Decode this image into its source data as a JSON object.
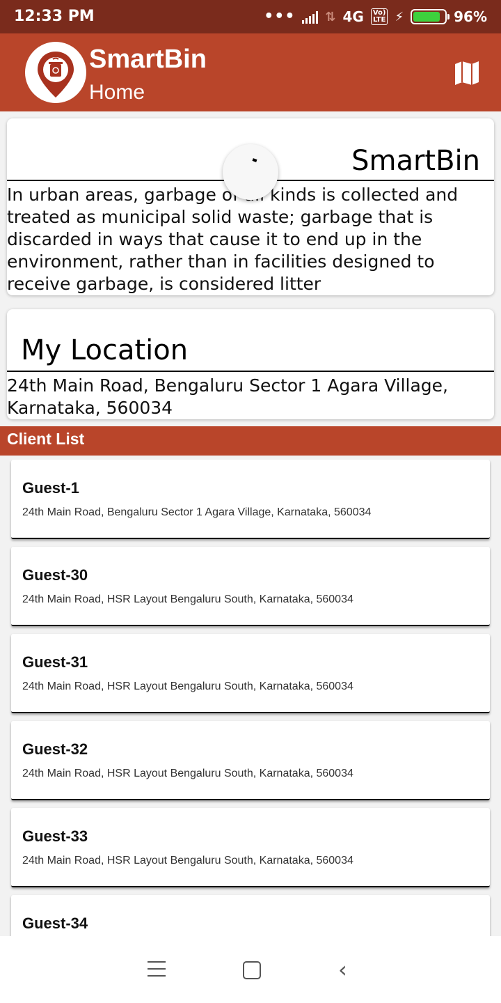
{
  "status_bar": {
    "time": "12:33 PM",
    "dots": "•••",
    "network": "4G",
    "volte": "Vo) LTE",
    "battery_level_percent": 96,
    "battery_text": "96%"
  },
  "app_bar": {
    "title": "SmartBin",
    "subtitle": "Home",
    "map_icon": "map-icon",
    "logo_icon": "smartbin-logo-icon"
  },
  "info_card": {
    "title": "SmartBin",
    "body": "In urban areas, garbage of all kinds is collected and treated as municipal solid waste; garbage that is discarded in ways that cause it to end up in the environment, rather than in facilities designed to receive garbage, is considered litter"
  },
  "location_card": {
    "title": "My Location",
    "address": "24th Main Road, Bengaluru Sector 1 Agara Village, Karnataka, 560034"
  },
  "client_list": {
    "header": "Client List",
    "items": [
      {
        "name": "Guest-1",
        "address": "24th Main Road, Bengaluru Sector 1 Agara Village, Karnataka, 560034"
      },
      {
        "name": "Guest-30",
        "address": "24th Main Road, HSR Layout Bengaluru South, Karnataka, 560034"
      },
      {
        "name": "Guest-31",
        "address": "24th Main Road, HSR Layout Bengaluru South, Karnataka, 560034"
      },
      {
        "name": "Guest-32",
        "address": "24th Main Road, HSR Layout Bengaluru South, Karnataka, 560034"
      },
      {
        "name": "Guest-33",
        "address": "24th Main Road, HSR Layout Bengaluru South, Karnataka, 560034"
      },
      {
        "name": "Guest-34",
        "address": ""
      }
    ]
  },
  "nav_bar": {
    "menu_icon": "menu-icon",
    "home_icon": "home-square-icon",
    "back_icon": "back-chevron-icon"
  },
  "colors": {
    "status_bar": "#7a2b1c",
    "app_bar": "#b9452a",
    "battery_fill": "#3dd13d"
  }
}
